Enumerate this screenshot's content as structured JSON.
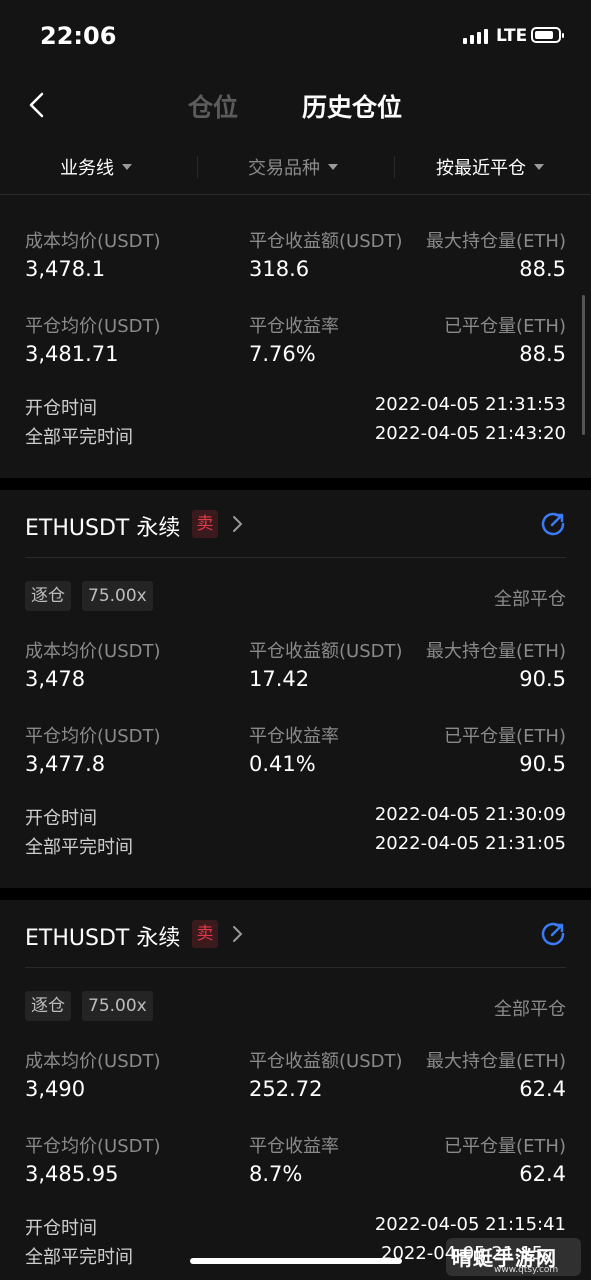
{
  "status_bar": {
    "time": "22:06",
    "network": "LTE"
  },
  "header": {
    "back_icon": "chevron-left-icon",
    "tab_positions": "仓位",
    "tab_history": "历史仓位"
  },
  "filters": [
    "业务线",
    "交易品种",
    "按最近平仓"
  ],
  "labels": {
    "cost_avg": "成本均价(USDT)",
    "close_pnl": "平仓收益额(USDT)",
    "max_hold": "最大持仓量(ETH)",
    "close_avg": "平仓均价(USDT)",
    "close_rate": "平仓收益率",
    "closed_qty": "已平仓量(ETH)",
    "open_time": "开仓时间",
    "full_close_time": "全部平完时间"
  },
  "cards": [
    {
      "cost_avg": "3,478.1",
      "close_pnl": "318.6",
      "max_hold": "88.5",
      "close_avg": "3,481.71",
      "close_rate": "7.76%",
      "closed_qty": "88.5",
      "open_time": "2022-04-05 21:31:53",
      "full_close_time": "2022-04-05 21:43:20"
    },
    {
      "title": "ETHUSDT 永续",
      "side": "卖",
      "margin_mode": "逐仓",
      "leverage": "75.00x",
      "status": "全部平仓",
      "cost_avg": "3,478",
      "close_pnl": "17.42",
      "max_hold": "90.5",
      "close_avg": "3,477.8",
      "close_rate": "0.41%",
      "closed_qty": "90.5",
      "open_time": "2022-04-05 21:30:09",
      "full_close_time": "2022-04-05 21:31:05"
    },
    {
      "title": "ETHUSDT 永续",
      "side": "卖",
      "margin_mode": "逐仓",
      "leverage": "75.00x",
      "status": "全部平仓",
      "cost_avg": "3,490",
      "close_pnl": "252.72",
      "max_hold": "62.4",
      "close_avg": "3,485.95",
      "close_rate": "8.7%",
      "closed_qty": "62.4",
      "open_time": "2022-04-05 21:15:41",
      "full_close_time": "2022-04-05 21:15:"
    }
  ],
  "watermark": {
    "text": "晴蜓手游网",
    "url": "www.qtsy.com"
  },
  "colors": {
    "background": "#141414",
    "sell": "#e03a48",
    "accent": "#3b7bf6",
    "muted": "#8a8a8a"
  }
}
